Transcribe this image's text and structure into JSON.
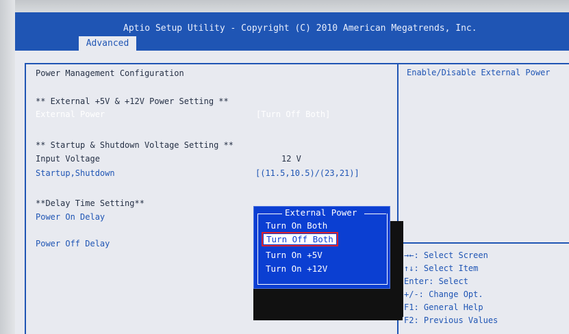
{
  "header": {
    "title": "Aptio Setup Utility - Copyright (C) 2010 American Megatrends, Inc.",
    "active_tab": "Advanced"
  },
  "content": {
    "heading": "Power Management Configuration",
    "section_external": "** External +5V & +12V Power Setting **",
    "external_power": {
      "label": "External Power",
      "value": "[Turn Off Both]"
    },
    "section_startup": "** Startup & Shutdown Voltage Setting **",
    "input_voltage": {
      "label": "Input Voltage",
      "value": "12 V"
    },
    "startup_shutdown": {
      "label": "Startup,Shutdown",
      "value": "[(11.5,10.5)/(23,21)]"
    },
    "section_delay": "**Delay Time Setting**",
    "power_on_delay": {
      "label": "Power On Delay"
    },
    "power_off_delay": {
      "label": "Power Off Delay"
    }
  },
  "help": {
    "description": "Enable/Disable External Power",
    "keys": [
      "→←: Select Screen",
      "↑↓: Select Item",
      "Enter: Select",
      "+/-: Change Opt.",
      "F1: General Help",
      "F2: Previous Values"
    ]
  },
  "popup": {
    "title": "External Power",
    "options": [
      "Turn On Both",
      "Turn Off Both",
      "Turn On +5V",
      "Turn On +12V"
    ],
    "selected": "Turn Off Both"
  },
  "colors": {
    "bios_blue": "#1f55b4",
    "popup_blue": "#0b3fd2",
    "highlight_outline": "#e0232d"
  }
}
